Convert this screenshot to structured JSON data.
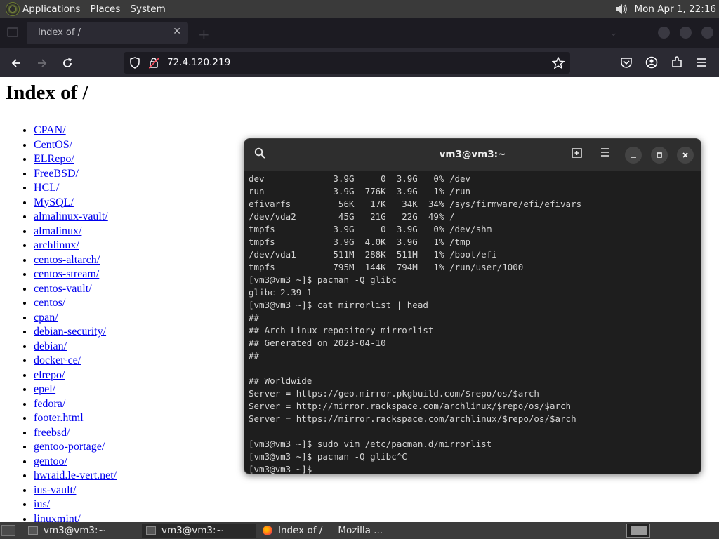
{
  "top_panel": {
    "menus": [
      "Applications",
      "Places",
      "System"
    ],
    "clock": "Mon Apr 1, 22:16"
  },
  "browser": {
    "tab_title": "Index of /",
    "url": "72.4.120.219"
  },
  "page": {
    "heading": "Index of /",
    "links": [
      "CPAN/",
      "CentOS/",
      "ELRepo/",
      "FreeBSD/",
      "HCL/",
      "MySQL/",
      "almalinux-vault/",
      "almalinux/",
      "archlinux/",
      "centos-altarch/",
      "centos-stream/",
      "centos-vault/",
      "centos/",
      "cpan/",
      "debian-security/",
      "debian/",
      "docker-ce/",
      "elrepo/",
      "epel/",
      "fedora/",
      "footer.html",
      "freebsd/",
      "gentoo-portage/",
      "gentoo/",
      "hwraid.le-vert.net/",
      "ius-vault/",
      "ius/",
      "linuxmint/"
    ]
  },
  "terminal": {
    "title": "vm3@vm3:~",
    "lines": [
      "dev             3.9G     0  3.9G   0% /dev",
      "run             3.9G  776K  3.9G   1% /run",
      "efivarfs         56K   17K   34K  34% /sys/firmware/efi/efivars",
      "/dev/vda2        45G   21G   22G  49% /",
      "tmpfs           3.9G     0  3.9G   0% /dev/shm",
      "tmpfs           3.9G  4.0K  3.9G   1% /tmp",
      "/dev/vda1       511M  288K  511M   1% /boot/efi",
      "tmpfs           795M  144K  794M   1% /run/user/1000",
      "[vm3@vm3 ~]$ pacman -Q glibc",
      "glibc 2.39-1",
      "[vm3@vm3 ~]$ cat mirrorlist | head",
      "##",
      "## Arch Linux repository mirrorlist",
      "## Generated on 2023-04-10",
      "##",
      "",
      "## Worldwide",
      "Server = https://geo.mirror.pkgbuild.com/$repo/os/$arch",
      "Server = http://mirror.rackspace.com/archlinux/$repo/os/$arch",
      "Server = https://mirror.rackspace.com/archlinux/$repo/os/$arch",
      "",
      "[vm3@vm3 ~]$ sudo vim /etc/pacman.d/mirrorlist",
      "[vm3@vm3 ~]$ pacman -Q glibc^C",
      "[vm3@vm3 ~]$ "
    ]
  },
  "taskbar": {
    "items": [
      "vm3@vm3:~",
      "vm3@vm3:~",
      "Index of / — Mozilla ..."
    ]
  }
}
